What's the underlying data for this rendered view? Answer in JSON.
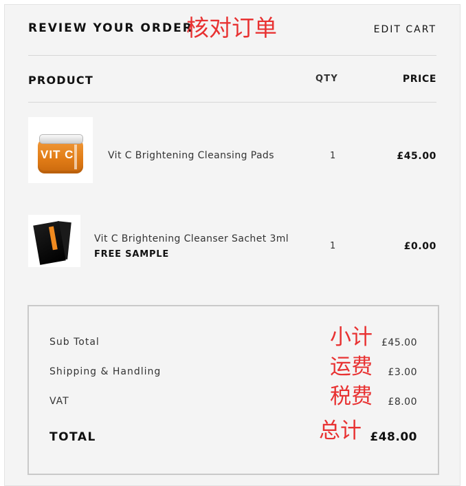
{
  "header": {
    "title": "REVIEW YOUR ORDER",
    "title_annotation": "核对订单",
    "edit_cart_label": "EDIT CART"
  },
  "columns": {
    "product": "PRODUCT",
    "qty": "QTY",
    "price": "PRICE"
  },
  "items": [
    {
      "name": "Vit C Brightening Cleansing Pads",
      "image_text": "VIT C",
      "qty": "1",
      "price": "£45.00"
    },
    {
      "name": "Vit C Brightening Cleanser Sachet 3ml",
      "tag": "FREE SAMPLE",
      "qty": "1",
      "price": "£0.00"
    }
  ],
  "summary": {
    "subtotal": {
      "label": "Sub Total",
      "annotation": "小计",
      "value": "£45.00"
    },
    "shipping": {
      "label": "Shipping & Handling",
      "annotation": "运费",
      "value": "£3.00"
    },
    "vat": {
      "label": "VAT",
      "annotation": "税费",
      "value": "£8.00"
    },
    "total": {
      "label": "TOTAL",
      "annotation": "总计",
      "value": "£48.00"
    }
  },
  "colors": {
    "panel_background": "#f4f4f4",
    "annotation_red": "#e83232",
    "product_orange": "#e07b16"
  }
}
